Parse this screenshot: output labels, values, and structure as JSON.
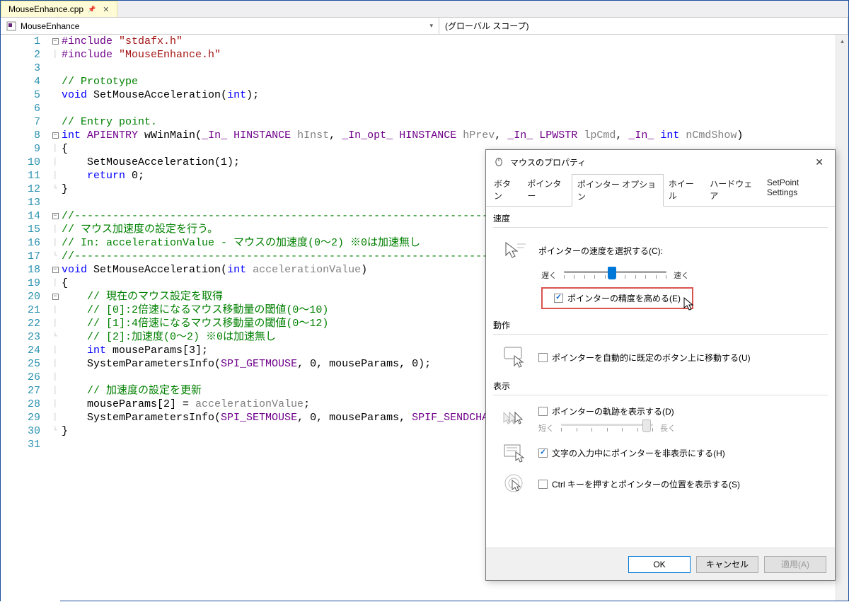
{
  "tab": {
    "filename": "MouseEnhance.cpp"
  },
  "nav": {
    "project": "MouseEnhance",
    "scope": "(グローバル スコープ)"
  },
  "code": {
    "lines": [
      {
        "n": 1,
        "fold": "minus",
        "tokens": [
          {
            "t": "#include ",
            "c": "c-mac"
          },
          {
            "t": "\"stdafx.h\"",
            "c": "c-str"
          }
        ]
      },
      {
        "n": 2,
        "fold": "bar",
        "tokens": [
          {
            "t": "#include ",
            "c": "c-mac"
          },
          {
            "t": "\"MouseEnhance.h\"",
            "c": "c-str"
          }
        ]
      },
      {
        "n": 3,
        "fold": "",
        "tokens": []
      },
      {
        "n": 4,
        "fold": "",
        "tokens": [
          {
            "t": "// Prototype",
            "c": "c-com"
          }
        ]
      },
      {
        "n": 5,
        "fold": "",
        "tokens": [
          {
            "t": "void",
            "c": "c-key"
          },
          {
            "t": " SetMouseAcceleration(",
            "c": ""
          },
          {
            "t": "int",
            "c": "c-key"
          },
          {
            "t": ");",
            "c": ""
          }
        ]
      },
      {
        "n": 6,
        "fold": "",
        "tokens": []
      },
      {
        "n": 7,
        "fold": "",
        "tokens": [
          {
            "t": "// Entry point.",
            "c": "c-com"
          }
        ]
      },
      {
        "n": 8,
        "fold": "minus",
        "tokens": [
          {
            "t": "int",
            "c": "c-key"
          },
          {
            "t": " ",
            "c": ""
          },
          {
            "t": "APIENTRY",
            "c": "c-mac"
          },
          {
            "t": " wWinMain(",
            "c": ""
          },
          {
            "t": "_In_",
            "c": "c-mac"
          },
          {
            "t": " ",
            "c": ""
          },
          {
            "t": "HINSTANCE",
            "c": "c-mac"
          },
          {
            "t": " ",
            "c": ""
          },
          {
            "t": "hInst",
            "c": "c-param"
          },
          {
            "t": ", ",
            "c": ""
          },
          {
            "t": "_In_opt_",
            "c": "c-mac"
          },
          {
            "t": " ",
            "c": ""
          },
          {
            "t": "HINSTANCE",
            "c": "c-mac"
          },
          {
            "t": " ",
            "c": ""
          },
          {
            "t": "hPrev",
            "c": "c-param"
          },
          {
            "t": ", ",
            "c": ""
          },
          {
            "t": "_In_",
            "c": "c-mac"
          },
          {
            "t": " ",
            "c": ""
          },
          {
            "t": "LPWSTR",
            "c": "c-mac"
          },
          {
            "t": " ",
            "c": ""
          },
          {
            "t": "lpCmd",
            "c": "c-param"
          },
          {
            "t": ", ",
            "c": ""
          },
          {
            "t": "_In_",
            "c": "c-mac"
          },
          {
            "t": " ",
            "c": ""
          },
          {
            "t": "int",
            "c": "c-key"
          },
          {
            "t": " ",
            "c": ""
          },
          {
            "t": "nCmdShow",
            "c": "c-param"
          },
          {
            "t": ")",
            "c": ""
          }
        ]
      },
      {
        "n": 9,
        "fold": "bar",
        "tokens": [
          {
            "t": "{",
            "c": ""
          }
        ]
      },
      {
        "n": 10,
        "fold": "bar",
        "tokens": [
          {
            "t": "    SetMouseAcceleration(1);",
            "c": ""
          }
        ]
      },
      {
        "n": 11,
        "fold": "bar",
        "tokens": [
          {
            "t": "    ",
            "c": ""
          },
          {
            "t": "return",
            "c": "c-key"
          },
          {
            "t": " 0;",
            "c": ""
          }
        ]
      },
      {
        "n": 12,
        "fold": "end",
        "tokens": [
          {
            "t": "}",
            "c": ""
          }
        ]
      },
      {
        "n": 13,
        "fold": "",
        "tokens": []
      },
      {
        "n": 14,
        "fold": "minus",
        "tokens": [
          {
            "t": "//----------------------------------------------------------------------",
            "c": "c-com"
          }
        ]
      },
      {
        "n": 15,
        "fold": "bar",
        "tokens": [
          {
            "t": "// マウス加速度の設定を行う。",
            "c": "c-com"
          }
        ]
      },
      {
        "n": 16,
        "fold": "bar",
        "tokens": [
          {
            "t": "// In: accelerationValue - マウスの加速度(0～2) ※0は加速無し",
            "c": "c-com"
          }
        ]
      },
      {
        "n": 17,
        "fold": "end",
        "tokens": [
          {
            "t": "//----------------------------------------------------------------------",
            "c": "c-com"
          }
        ]
      },
      {
        "n": 18,
        "fold": "minus",
        "tokens": [
          {
            "t": "void",
            "c": "c-key"
          },
          {
            "t": " SetMouseAcceleration(",
            "c": ""
          },
          {
            "t": "int",
            "c": "c-key"
          },
          {
            "t": " ",
            "c": ""
          },
          {
            "t": "accelerationValue",
            "c": "c-param"
          },
          {
            "t": ")",
            "c": ""
          }
        ]
      },
      {
        "n": 19,
        "fold": "bar",
        "tokens": [
          {
            "t": "{",
            "c": ""
          }
        ]
      },
      {
        "n": 20,
        "fold": "minus",
        "tokens": [
          {
            "t": "    ",
            "c": ""
          },
          {
            "t": "// 現在のマウス設定を取得",
            "c": "c-com"
          }
        ]
      },
      {
        "n": 21,
        "fold": "bar",
        "tokens": [
          {
            "t": "    ",
            "c": ""
          },
          {
            "t": "// [0]:2倍速になるマウス移動量の閾値(0～10)",
            "c": "c-com"
          }
        ]
      },
      {
        "n": 22,
        "fold": "bar",
        "tokens": [
          {
            "t": "    ",
            "c": ""
          },
          {
            "t": "// [1]:4倍速になるマウス移動量の閾値(0～12)",
            "c": "c-com"
          }
        ]
      },
      {
        "n": 23,
        "fold": "end",
        "tokens": [
          {
            "t": "    ",
            "c": ""
          },
          {
            "t": "// [2]:加速度(0～2) ※0は加速無し",
            "c": "c-com"
          }
        ]
      },
      {
        "n": 24,
        "fold": "bar",
        "tokens": [
          {
            "t": "    ",
            "c": ""
          },
          {
            "t": "int",
            "c": "c-key"
          },
          {
            "t": " mouseParams[3];",
            "c": ""
          }
        ]
      },
      {
        "n": 25,
        "fold": "bar",
        "tokens": [
          {
            "t": "    SystemParametersInfo(",
            "c": ""
          },
          {
            "t": "SPI_GETMOUSE",
            "c": "c-mac"
          },
          {
            "t": ", 0, mouseParams, 0);",
            "c": ""
          }
        ]
      },
      {
        "n": 26,
        "fold": "bar",
        "tokens": []
      },
      {
        "n": 27,
        "fold": "bar",
        "tokens": [
          {
            "t": "    ",
            "c": ""
          },
          {
            "t": "// 加速度の設定を更新",
            "c": "c-com"
          }
        ]
      },
      {
        "n": 28,
        "fold": "bar",
        "tokens": [
          {
            "t": "    mouseParams[2] = ",
            "c": ""
          },
          {
            "t": "accelerationValue",
            "c": "c-param"
          },
          {
            "t": ";",
            "c": ""
          }
        ]
      },
      {
        "n": 29,
        "fold": "bar",
        "tokens": [
          {
            "t": "    SystemParametersInfo(",
            "c": ""
          },
          {
            "t": "SPI_SETMOUSE",
            "c": "c-mac"
          },
          {
            "t": ", 0, mouseParams, ",
            "c": ""
          },
          {
            "t": "SPIF_SENDCHANGE",
            "c": "c-mac"
          },
          {
            "t": ");",
            "c": ""
          }
        ]
      },
      {
        "n": 30,
        "fold": "end",
        "tokens": [
          {
            "t": "}",
            "c": ""
          }
        ]
      },
      {
        "n": 31,
        "fold": "",
        "tokens": []
      }
    ]
  },
  "dialog": {
    "title": "マウスのプロパティ",
    "tabs": [
      "ボタン",
      "ポインター",
      "ポインター オプション",
      "ホイール",
      "ハードウェア",
      "SetPoint Settings"
    ],
    "active_tab": 2,
    "groups": {
      "speed": {
        "title": "速度",
        "label": "ポインターの速度を選択する(C):",
        "slow": "遅く",
        "fast": "速く",
        "precision": "ポインターの精度を高める(E)",
        "precision_checked": true
      },
      "action": {
        "title": "動作",
        "auto_move": "ポインターを自動的に既定のボタン上に移動する(U)",
        "auto_move_checked": false
      },
      "display": {
        "title": "表示",
        "trail": "ポインターの軌跡を表示する(D)",
        "trail_checked": false,
        "trail_short": "短く",
        "trail_long": "長く",
        "hide_typing": "文字の入力中にポインターを非表示にする(H)",
        "hide_typing_checked": true,
        "ctrl_locate": "Ctrl キーを押すとポインターの位置を表示する(S)",
        "ctrl_locate_checked": false
      }
    },
    "buttons": {
      "ok": "OK",
      "cancel": "キャンセル",
      "apply": "適用(A)"
    }
  }
}
